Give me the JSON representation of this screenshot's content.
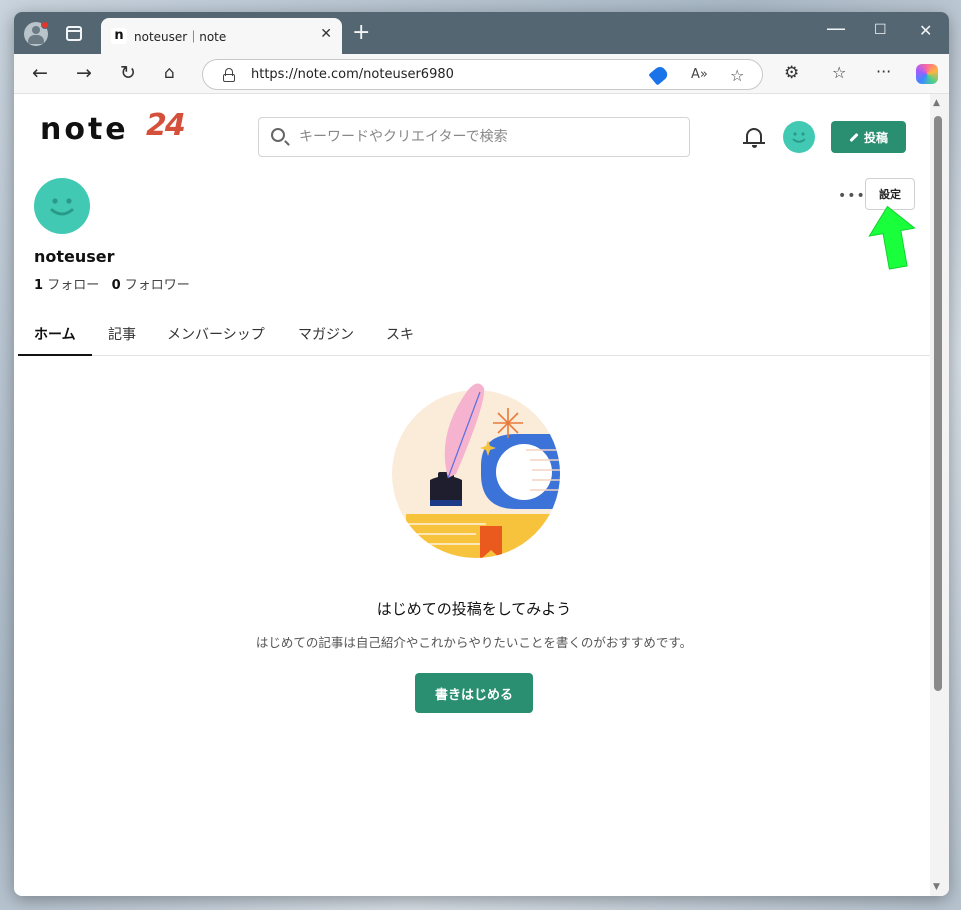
{
  "browser": {
    "tab_title": "noteuser｜note",
    "tab_favicon": "n",
    "url": "https://note.com/noteuser6980",
    "icons": [
      "profile-icon",
      "tabs-icon",
      "close-icon",
      "new-tab-icon",
      "minimize-icon",
      "maximize-icon",
      "window-close-icon",
      "back-icon",
      "forward-icon",
      "refresh-icon",
      "home-icon",
      "lock-icon",
      "coupon-tag-icon",
      "read-aloud-icon",
      "favorite-star-icon",
      "extensions-icon",
      "favorites-icon",
      "more-icon",
      "copilot-icon"
    ]
  },
  "header": {
    "logo_text": "note",
    "logo_badge": "24",
    "search_placeholder": "キーワードやクリエイターで検索",
    "post_label": "投稿"
  },
  "profile": {
    "username": "noteuser",
    "follow_count": "1",
    "follow_label": "フォロー",
    "follower_count": "0",
    "follower_label": "フォロワー",
    "more_label": "•••",
    "settings_label": "設定"
  },
  "tabs": [
    {
      "label": "ホーム",
      "active": true
    },
    {
      "label": "記事"
    },
    {
      "label": "メンバーシップ"
    },
    {
      "label": "マガジン"
    },
    {
      "label": "スキ"
    }
  ],
  "empty_state": {
    "title": "はじめての投稿をしてみよう",
    "description": "はじめての記事は自己紹介やこれからやりたいことを書くのがおすすめです。",
    "button_label": "書きはじめる"
  },
  "colors": {
    "brand_green": "#2a8f71",
    "avatar": "#41c9b4",
    "annotation_arrow": "#1aff3c",
    "tabbar": "#536672"
  }
}
